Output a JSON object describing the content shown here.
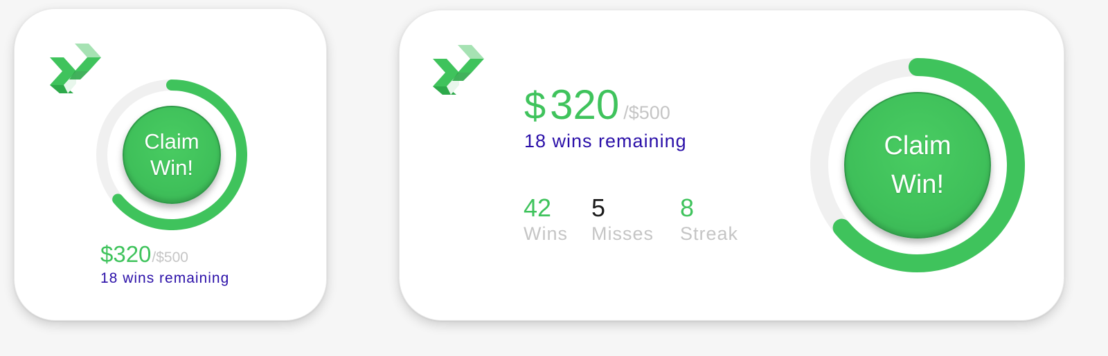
{
  "colors": {
    "accent": "#3fc35c",
    "track": "#efefef",
    "text_blue": "#2a0fa8",
    "text_grey": "#c5c5c5"
  },
  "small_widget": {
    "logo_icon": "stacked-blocks-logo-icon",
    "progress_fraction": 0.64,
    "button_label": "Claim\nWin!",
    "amount": "$320",
    "goal": "/$500",
    "remaining": "18 wins remaining"
  },
  "large_widget": {
    "logo_icon": "stacked-blocks-logo-icon",
    "progress_fraction": 0.64,
    "button_label": "Claim\nWin!",
    "currency": "$",
    "amount": "320",
    "goal": "/$500",
    "remaining": "18 wins remaining",
    "stats": [
      {
        "value": "42",
        "label": "Wins"
      },
      {
        "value": "5",
        "label": "Misses"
      },
      {
        "value": "8",
        "label": "Streak"
      }
    ]
  }
}
